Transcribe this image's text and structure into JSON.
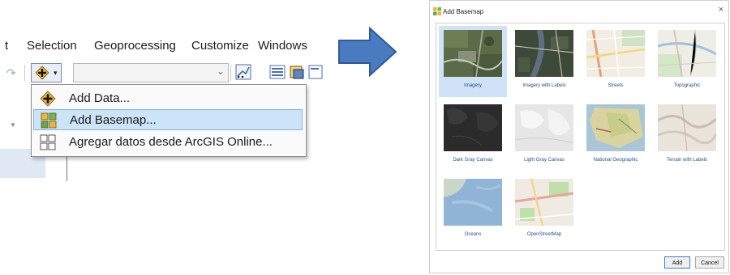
{
  "menu": {
    "items": [
      "t",
      "Selection",
      "Geoprocessing",
      "Customize",
      "Windows"
    ]
  },
  "toolbar": {
    "add_data_icon": "add-data-plus-icon",
    "dropdown_arrow": "▾",
    "combo_value": ""
  },
  "dropdown": {
    "items": [
      {
        "label": "Add Data...",
        "icon": "add-data-plus-icon"
      },
      {
        "label": "Add Basemap...",
        "icon": "basemap-grid-icon"
      },
      {
        "label": "Agregar datos desde ArcGIS Online...",
        "icon": "arcgis-online-grid-icon"
      }
    ],
    "active_index": 1
  },
  "dialog": {
    "title": "Add Basemap",
    "close_glyph": "×",
    "tiles": [
      {
        "label": "Imagery",
        "selected": true
      },
      {
        "label": "Imagery with Labels",
        "selected": false
      },
      {
        "label": "Streets",
        "selected": false
      },
      {
        "label": "Topographic",
        "selected": false
      },
      {
        "label": "Dark Gray Canvas",
        "selected": false
      },
      {
        "label": "Light Gray Canvas",
        "selected": false
      },
      {
        "label": "National Geographic",
        "selected": false
      },
      {
        "label": "Terrain with Labels",
        "selected": false
      },
      {
        "label": "Oceans",
        "selected": false
      },
      {
        "label": "OpenStreetMap",
        "selected": false
      }
    ],
    "buttons": {
      "add": "Add",
      "cancel": "Cancel"
    }
  },
  "colors": {
    "arrow": "#4a7bc0",
    "selection": "#cde3f7",
    "tile_caption": "#2a4d8a"
  }
}
